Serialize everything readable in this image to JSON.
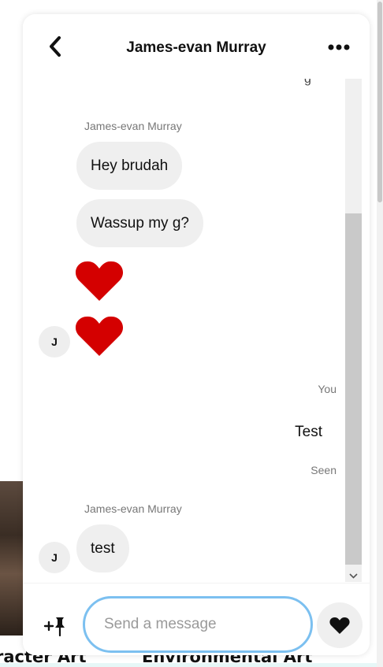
{
  "background": {
    "caption_left": "racter Art",
    "caption_right": "Environmental Art"
  },
  "header": {
    "title": "James-evan Murray",
    "back_icon": "chevron-left-icon",
    "more_icon": "ellipsis-icon"
  },
  "messages": {
    "groups": [
      {
        "sender": "James-evan Murray",
        "bubbles": [
          "Hey brudah",
          "Wassup my g?"
        ],
        "hearts": 2,
        "avatar_initial": "J"
      },
      {
        "sender": "You",
        "text": "Test",
        "status": "Seen"
      },
      {
        "sender": "James-evan Murray",
        "bubbles": [
          "test"
        ],
        "avatar_initial": "J"
      }
    ],
    "heart_color": "#d40000"
  },
  "composer": {
    "placeholder": "Send a message",
    "value": "",
    "attach_icon": "pin-add-icon",
    "like_icon": "heart-icon",
    "focus_color": "#7cc0f0"
  }
}
